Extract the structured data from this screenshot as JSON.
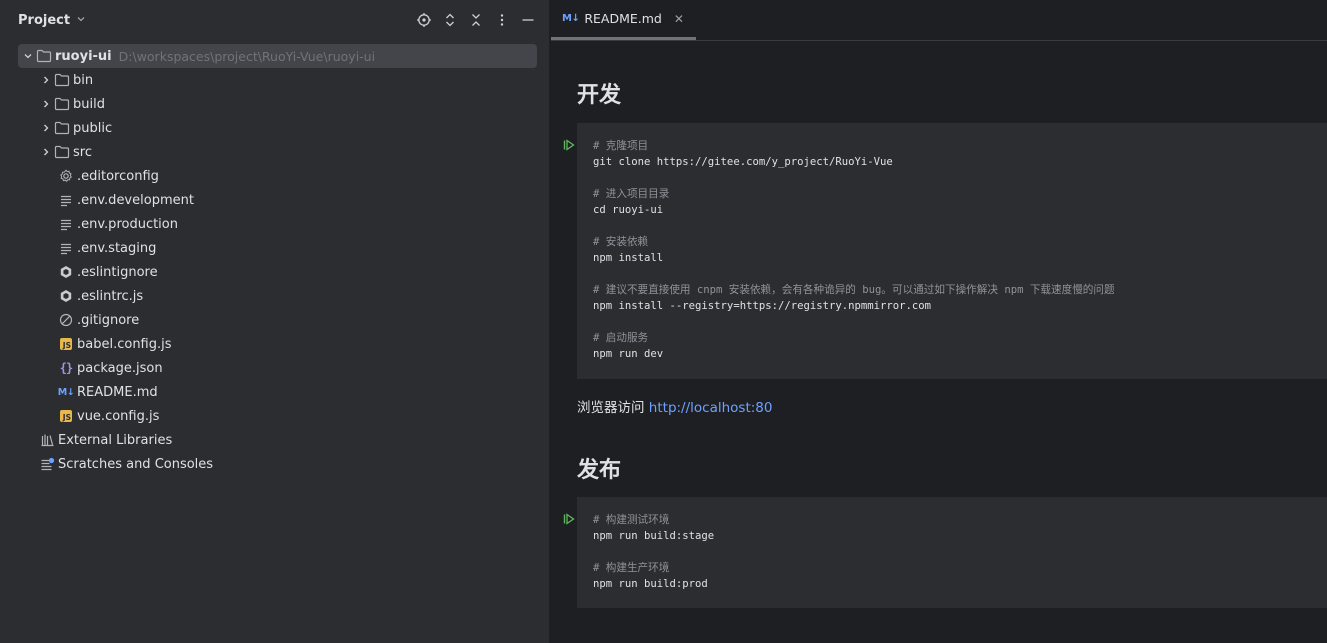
{
  "project_panel": {
    "title": "Project",
    "root": {
      "name": "ruoyi-ui",
      "path": "D:\\workspaces\\project\\RuoYi-Vue\\ruoyi-ui"
    },
    "folders": [
      "bin",
      "build",
      "public",
      "src"
    ],
    "files": [
      {
        "name": ".editorconfig",
        "icon": "gear-icon"
      },
      {
        "name": ".env.development",
        "icon": "text-file-icon"
      },
      {
        "name": ".env.production",
        "icon": "text-file-icon"
      },
      {
        "name": ".env.staging",
        "icon": "text-file-icon"
      },
      {
        "name": ".eslintignore",
        "icon": "eslint-icon"
      },
      {
        "name": ".eslintrc.js",
        "icon": "eslint-icon"
      },
      {
        "name": ".gitignore",
        "icon": "ignore-icon"
      },
      {
        "name": "babel.config.js",
        "icon": "js-file-icon"
      },
      {
        "name": "package.json",
        "icon": "json-file-icon"
      },
      {
        "name": "README.md",
        "icon": "markdown-file-icon"
      },
      {
        "name": "vue.config.js",
        "icon": "js-file-icon"
      }
    ],
    "extras": [
      {
        "name": "External Libraries",
        "icon": "library-icon"
      },
      {
        "name": "Scratches and Consoles",
        "icon": "scratches-icon"
      }
    ],
    "md_badge": "M↓",
    "js_badge": "JS",
    "json_badge": "{}"
  },
  "editor": {
    "tab": {
      "badge": "M↓",
      "label": "README.md",
      "close": "✕"
    },
    "sections": [
      {
        "heading": "开发",
        "code": [
          "# 克隆项目",
          "git clone https://gitee.com/y_project/RuoYi-Vue",
          "",
          "# 进入项目目录",
          "cd ruoyi-ui",
          "",
          "# 安装依赖",
          "npm install",
          "",
          "# 建议不要直接使用 cnpm 安装依赖，会有各种诡异的 bug。可以通过如下操作解决 npm 下载速度慢的问题",
          "npm install --registry=https://registry.npmmirror.com",
          "",
          "# 启动服务",
          "npm run dev"
        ]
      },
      {
        "heading": "发布",
        "code": [
          "# 构建测试环境",
          "npm run build:stage",
          "",
          "# 构建生产环境",
          "npm run build:prod"
        ]
      }
    ],
    "paragraph": {
      "text": "浏览器访问 ",
      "link": "http://localhost:80"
    }
  },
  "colors": {
    "panel_bg": "#2b2d30",
    "editor_bg": "#1e1f22",
    "folder_icon": "#b0b3b9",
    "accent_link": "#6ea1ff",
    "run_icon": "#5fb85f"
  }
}
